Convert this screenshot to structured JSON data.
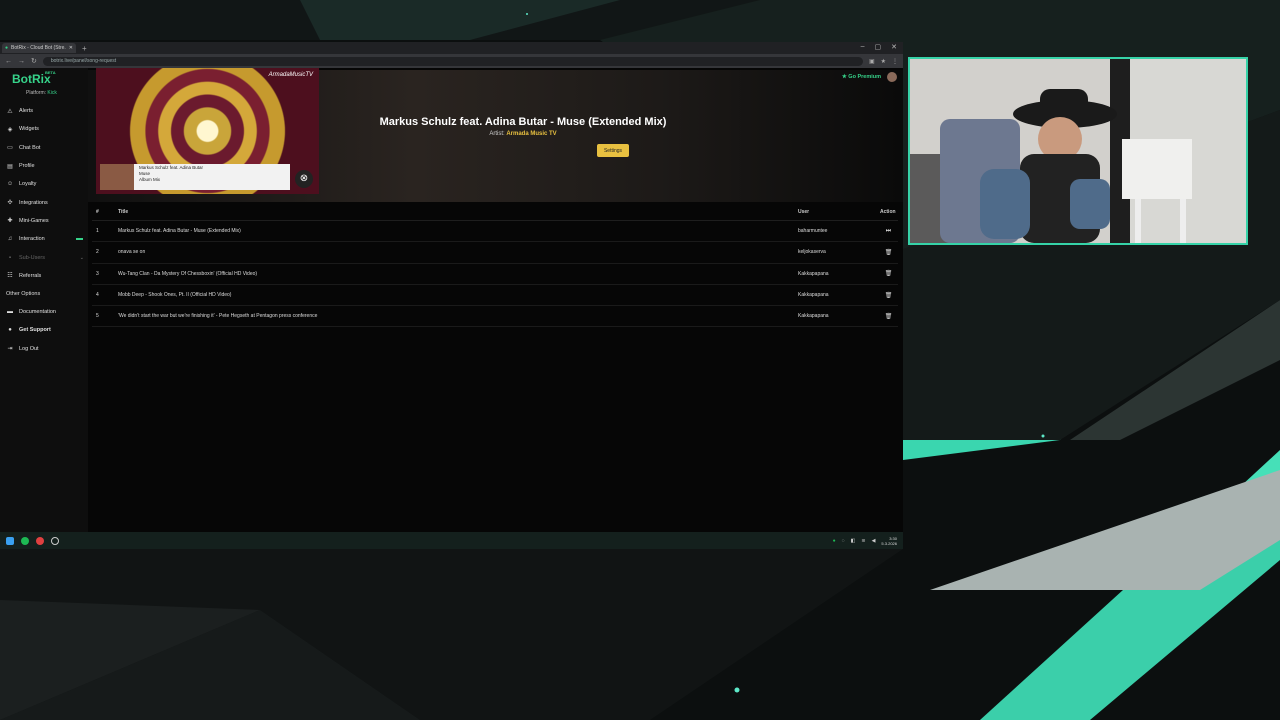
{
  "browser": {
    "tab_title": "BotRix - Cloud Bot (Stre...",
    "url": "botrix.live/panel/song-request"
  },
  "app": {
    "logo": "BotRix",
    "beta": "BETA",
    "platform_label": "Platform:",
    "platform_value": "Kick",
    "go_premium": "Go Premium"
  },
  "sidebar": {
    "items": [
      {
        "label": "Alerts",
        "icon": "alert-triangle-icon"
      },
      {
        "label": "Widgets",
        "icon": "layers-icon"
      },
      {
        "label": "Chat Bot",
        "icon": "chat-icon"
      },
      {
        "label": "Profile",
        "icon": "profile-icon"
      },
      {
        "label": "Loyalty",
        "icon": "loyalty-icon"
      },
      {
        "label": "Integrations",
        "icon": "integrations-icon"
      },
      {
        "label": "Mini-Games",
        "icon": "gamepad-icon"
      },
      {
        "label": "Interaction",
        "icon": "music-icon"
      },
      {
        "label": "Sub-Users",
        "icon": "users-icon"
      },
      {
        "label": "Referrals",
        "icon": "referrals-icon"
      }
    ],
    "other_heading": "Other Options",
    "other_items": [
      {
        "label": "Documentation",
        "icon": "document-icon"
      },
      {
        "label": "Get Support",
        "icon": "support-icon"
      },
      {
        "label": "Log Out",
        "icon": "logout-icon"
      }
    ]
  },
  "now_playing": {
    "title": "Markus Schulz feat. Adina Butar - Muse (Extended Mix)",
    "artist_label": "Artist:",
    "artist": "Armada Music TV",
    "settings_button": "Settings",
    "thumb_line1": "Markus Schulz feat. Adina Butar",
    "thumb_line2": "Muse",
    "thumb_line3": "Album Mix"
  },
  "queue": {
    "headers": {
      "num": "#",
      "title": "Title",
      "user": "User",
      "action": "Action"
    },
    "rows": [
      {
        "num": "1",
        "title": "Markus Schulz feat. Adina Butar - Muse (Extended Mix)",
        "user": "baharmuntee"
      },
      {
        "num": "2",
        "title": "onava se on",
        "user": "keljokaserva"
      },
      {
        "num": "3",
        "title": "Wu-Tang Clan - Da Mystery Of Chessboxin' (Official HD Video)",
        "user": "Kakkapapana"
      },
      {
        "num": "4",
        "title": "Mobb Deep - Shook Ones, Pt. II (Official HD Video)",
        "user": "Kakkapapana"
      },
      {
        "num": "5",
        "title": "'We didn't start the war but we're finishing it' - Pete Hegseth at Pentagon press conference",
        "user": "Kakkapapana"
      }
    ]
  },
  "taskbar": {
    "time": "3:30",
    "date": "5.3.2026"
  },
  "colors": {
    "accent": "#36d38a",
    "gold": "#e8c040",
    "webcam_border": "#36d3a8"
  }
}
